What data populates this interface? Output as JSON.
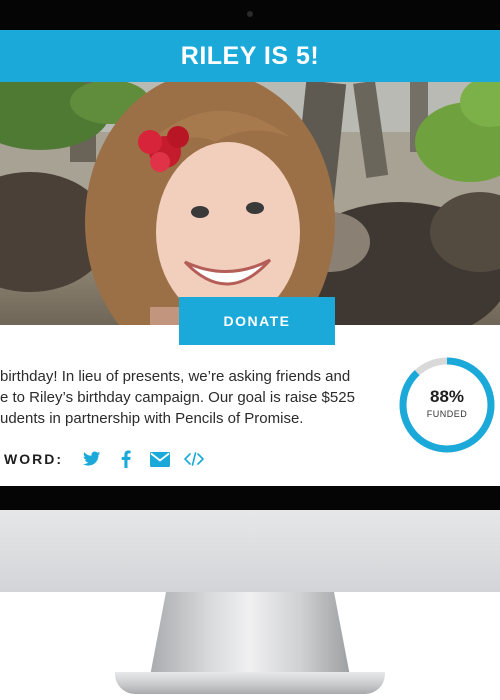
{
  "campaign": {
    "title": "RILEY IS 5!",
    "donate_label": "DONATE",
    "description_lines": [
      "birthday! In lieu of presents, we’re asking friends and",
      "e to Riley’s birthday campaign. Our goal is raise $525",
      "udents in partnership with Pencils of Promise."
    ],
    "progress": {
      "percent_text": "88%",
      "label": "FUNDED",
      "fraction": 0.88
    },
    "share": {
      "label": "WORD:",
      "icons": [
        "twitter-icon",
        "facebook-icon",
        "email-icon",
        "embed-code-icon"
      ]
    }
  },
  "colors": {
    "accent": "#1aa9d9",
    "bezel": "#050505",
    "ring_track": "#d9d9d9"
  }
}
